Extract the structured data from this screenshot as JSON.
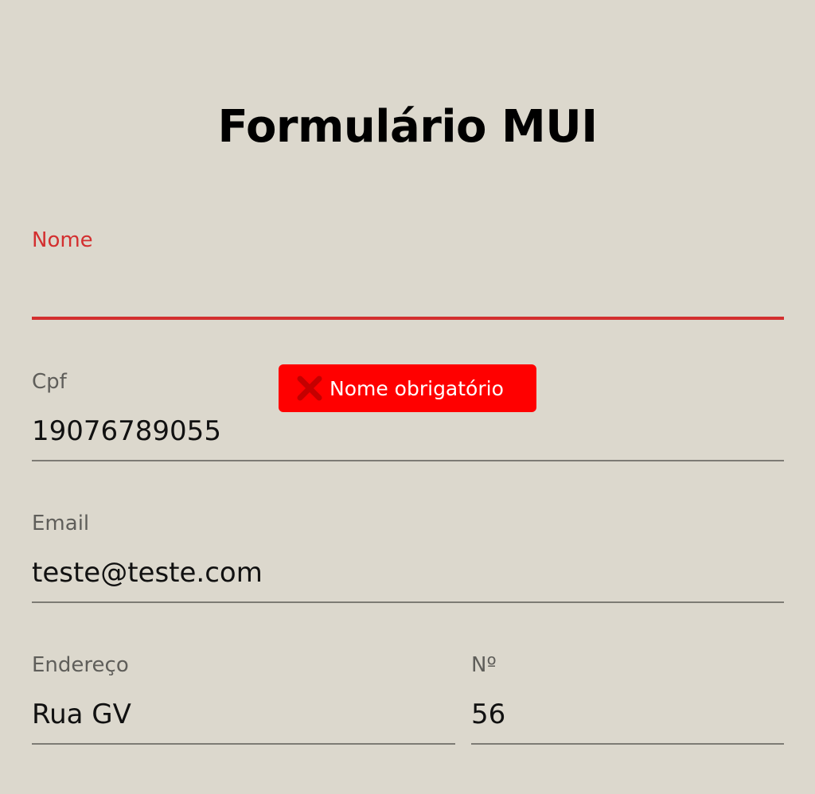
{
  "form": {
    "title": "Formulário MUI",
    "fields": {
      "nome": {
        "label": "Nome",
        "value": "",
        "state": "error"
      },
      "cpf": {
        "label": "Cpf",
        "value": "19076789055"
      },
      "email": {
        "label": "Email",
        "value": "teste@teste.com"
      },
      "endereco": {
        "label": "Endereço",
        "value": "Rua GV"
      },
      "numero": {
        "label": "Nº",
        "value": "56"
      }
    }
  },
  "toast": {
    "message": "Nome obrigatório",
    "icon": "close-icon",
    "type": "error"
  },
  "colors": {
    "background": "#dcd8cd",
    "error": "#d32f2f",
    "toast_background": "#ff0000",
    "label": "#5f5e5a",
    "text": "#111111",
    "underline": "#7d7b74"
  }
}
